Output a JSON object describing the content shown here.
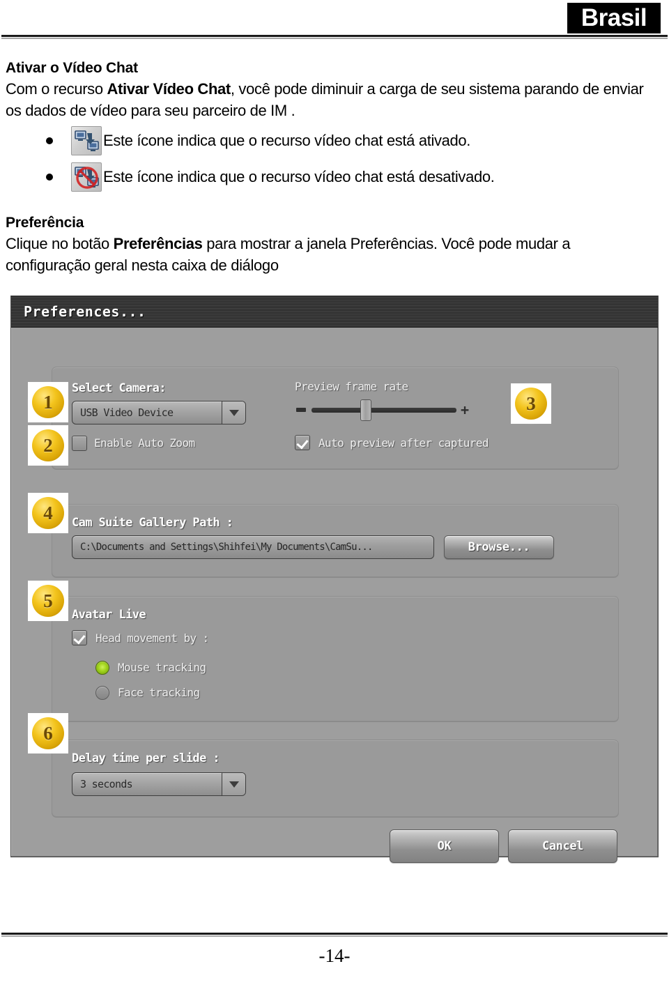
{
  "header": {
    "badge_label": "Brasil"
  },
  "document": {
    "section_heading": "Ativar o Vídeo Chat",
    "intro_paragraph_line1_pre": "Com o recurso ",
    "intro_paragraph_bold": "Ativar Vídeo Chat",
    "intro_paragraph_line1_post": ", você pode diminuir a carga de seu",
    "intro_paragraph_line2": "sistema parando de enviar os dados de vídeo para seu parceiro de IM .",
    "bullets": [
      {
        "icon": "video-chat-enabled-icon",
        "text": "Este ícone indica que o recurso vídeo chat está ativado."
      },
      {
        "icon": "video-chat-disabled-icon",
        "text": "Este ícone indica que o recurso vídeo chat está desativado."
      }
    ],
    "preference_heading": "Preferência",
    "preference_paragraph_pre": "Clique no botão ",
    "preference_paragraph_bold": "Preferências",
    "preference_paragraph_post": " para mostrar a janela Preferências. Você",
    "preference_paragraph_line2": "pode mudar a configuração geral nesta caixa de diálogo"
  },
  "dialog": {
    "title": "Preferences...",
    "select_camera_label": "Select Camera:",
    "camera_combo_value": "USB Video Device",
    "enable_auto_zoom_label": "Enable Auto Zoom",
    "enable_auto_zoom_checked": false,
    "preview_frame_rate_label": "Preview frame rate",
    "preview_frame_rate_minus": "−",
    "preview_frame_rate_plus": "+",
    "auto_preview_label": "Auto preview after captured",
    "auto_preview_checked": true,
    "gallery_path_label": "Cam Suite Gallery Path :",
    "gallery_path_value": "C:\\Documents and Settings\\Shihfei\\My Documents\\CamSu...",
    "browse_button_label": "Browse...",
    "avatar_live_label": "Avatar Live",
    "head_movement_label": "Head movement by :",
    "head_movement_checked": true,
    "mouse_tracking_label": "Mouse tracking",
    "face_tracking_label": "Face tracking",
    "selected_tracking": "Mouse tracking",
    "delay_time_label": "Delay time per slide :",
    "delay_time_value": "3 seconds",
    "ok_button_label": "OK",
    "cancel_button_label": "Cancel"
  },
  "callouts": [
    {
      "number": "1"
    },
    {
      "number": "2"
    },
    {
      "number": "3"
    },
    {
      "number": "4"
    },
    {
      "number": "5"
    },
    {
      "number": "6"
    }
  ],
  "footer": {
    "page_number": "-14-"
  },
  "colors": {
    "badge_background": "#000000",
    "badge_text": "#ffffff",
    "dialog_background": "#9e9e9e",
    "titlebar": "#2f2f2f",
    "callout_gold": "#f3c41d",
    "radio_on_green": "#9fd21a"
  }
}
